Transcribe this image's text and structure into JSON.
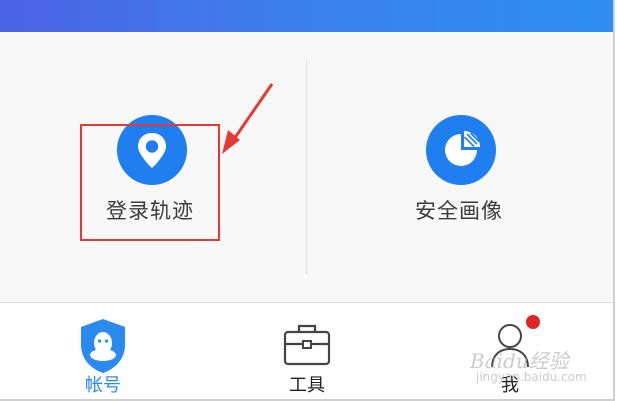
{
  "colors": {
    "header_gradient_start": "#4d63e6",
    "header_gradient_end": "#2f8ff0",
    "accent_blue": "#1f7ff0",
    "active_tab": "#2b8af0",
    "highlight_red": "#e53935",
    "badge_red": "#e02424"
  },
  "tools": [
    {
      "label": "登录轨迹",
      "icon": "location-pin-icon"
    },
    {
      "label": "安全画像",
      "icon": "pie-chart-icon"
    }
  ],
  "tabbar": {
    "items": [
      {
        "label": "帐号",
        "icon": "qq-shield-icon",
        "active": true
      },
      {
        "label": "工具",
        "icon": "toolbox-icon",
        "active": false
      },
      {
        "label": "我",
        "icon": "user-avatar-icon",
        "active": false,
        "badge": true
      }
    ]
  },
  "watermark": {
    "text": "Baidu经验",
    "sub": "jingyan.baidu.com"
  }
}
